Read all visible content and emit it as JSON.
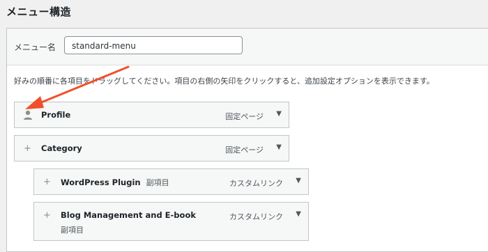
{
  "page": {
    "title": "メニュー構造"
  },
  "menu_name": {
    "label": "メニュー名",
    "value": "standard-menu"
  },
  "instructions": "好みの順番に各項目をドラッグしてください。項目の右側の矢印をクリックすると、追加設定オプションを表示できます。",
  "items": [
    {
      "handle": "",
      "title": "Profile",
      "sub": "",
      "type": "固定ページ",
      "toggle": "▼"
    },
    {
      "handle": "+",
      "title": "Category",
      "sub": "",
      "type": "固定ページ",
      "toggle": "▼"
    },
    {
      "handle": "+",
      "title": "WordPress Plugin",
      "sub": "副項目",
      "type": "カスタムリンク",
      "toggle": "▼"
    },
    {
      "handle": "+",
      "title": "Blog Management and E-book",
      "sub": "副項目",
      "type": "カスタムリンク",
      "toggle": "▼"
    }
  ],
  "colors": {
    "arrow": "#f0502a",
    "panel_border": "#c3c4c7",
    "item_bg": "#f6f7f7"
  }
}
